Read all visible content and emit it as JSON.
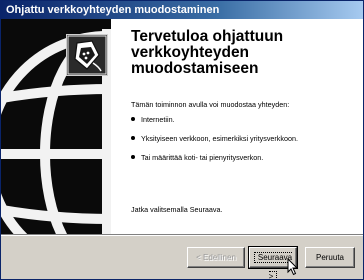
{
  "window": {
    "title": "Ohjattu verkkoyhteyden muodostaminen"
  },
  "icons": {
    "wizard": "network-connection-icon",
    "background": "globe-icon",
    "cursor": "mouse-pointer-icon"
  },
  "content": {
    "heading": "Tervetuloa ohjattuun verkkoyhteyden muodostamiseen",
    "intro": "Tämän toiminnon avulla voi muodostaa yhteyden:",
    "bullets": [
      "Internetiin.",
      "Yksityiseen verkkoon, esimerkiksi yritysverkkoon.",
      "Tai määrittää koti- tai pienyritysverkon."
    ],
    "footer": "Jatka valitsemalla Seuraava."
  },
  "buttons": {
    "back": "< Edellinen",
    "next": "Seuraava >",
    "cancel": "Peruuta"
  },
  "colors": {
    "titlebar_start": "#0a246a",
    "titlebar_end": "#a6caf0",
    "dialog_face": "#d4d0c8",
    "side_panel": "#0a0a0a"
  }
}
